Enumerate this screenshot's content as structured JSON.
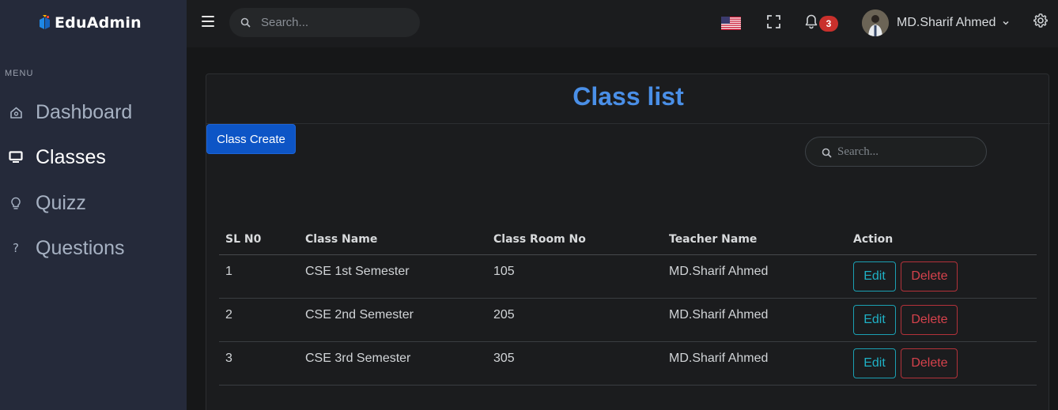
{
  "brand": {
    "name": "EduAdmin"
  },
  "sidebar": {
    "menu_title": "MENU",
    "items": [
      {
        "label": "Dashboard",
        "icon": "home-icon"
      },
      {
        "label": "Classes",
        "icon": "monitor-icon",
        "active": true
      },
      {
        "label": "Quizz",
        "icon": "lightbulb-icon"
      },
      {
        "label": "Questions",
        "icon": "question-icon"
      }
    ]
  },
  "topbar": {
    "search_placeholder": "Search...",
    "notification_count": "3",
    "user_name": "MD.Sharif Ahmed",
    "language_flag": "us-flag-icon"
  },
  "main": {
    "title": "Class list",
    "create_button": "Class Create",
    "table_search_placeholder": "Search...",
    "columns": [
      "SL N0",
      "Class Name",
      "Class Room No",
      "Teacher Name",
      "Action"
    ],
    "rows": [
      {
        "sl": "1",
        "class_name": "CSE 1st Semester",
        "room": "105",
        "teacher": "MD.Sharif Ahmed"
      },
      {
        "sl": "2",
        "class_name": "CSE 2nd Semester",
        "room": "205",
        "teacher": "MD.Sharif Ahmed"
      },
      {
        "sl": "3",
        "class_name": "CSE 3rd Semester",
        "room": "305",
        "teacher": "MD.Sharif Ahmed"
      }
    ],
    "edit_label": "Edit",
    "delete_label": "Delete"
  },
  "colors": {
    "accent": "#4a8fe7",
    "primary_button": "#0d55c6",
    "edit": "#1fb1c6",
    "delete": "#d6424c",
    "badge": "#c9302c"
  }
}
